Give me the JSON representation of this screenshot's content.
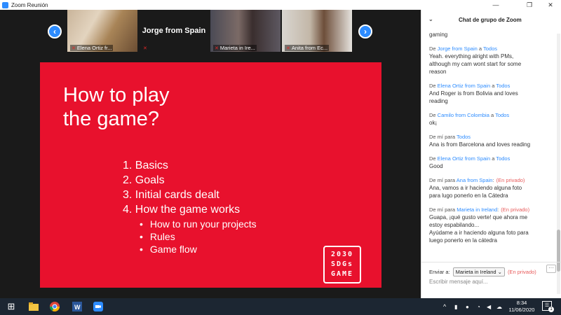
{
  "window": {
    "title": "Zoom Reunión",
    "minimize": "—",
    "restore": "❐",
    "close": "✕"
  },
  "gallery": {
    "prev_arrow": "‹",
    "next_arrow": "›",
    "tiles": [
      {
        "name": "Elena Ortiz fr..."
      },
      {
        "name": "Jorge from Spain"
      },
      {
        "name": "Marieta in Ire..."
      },
      {
        "name": "Anita from Ec..."
      }
    ],
    "mute_glyph": "✕"
  },
  "slide": {
    "title_line1": "How to play",
    "title_line2": "the game?",
    "items": [
      "1.  Basics",
      "2.  Goals",
      "3.  Initial cards dealt",
      "4.  How the game works"
    ],
    "subitems": [
      "How to run your projects",
      "Rules",
      "Game flow"
    ],
    "logo": [
      "2030",
      "SDGs",
      "GAME"
    ],
    "background": "#e8112d"
  },
  "chat": {
    "header_title": "Chat de grupo de Zoom",
    "collapse_icon": "⌄",
    "messages": [
      {
        "prefix": "",
        "who": "",
        "mid": "",
        "to": "",
        "private": "",
        "text": "gaming"
      },
      {
        "prefix": "De ",
        "who": "Jorge from Spain",
        "mid": " a ",
        "to": "Todos",
        "private": "",
        "text": "Yeah. everything alright with PMs,\nalthough my cam wont start for some\nreason"
      },
      {
        "prefix": "De ",
        "who": "Elena Ortiz from Spain",
        "mid": " a ",
        "to": "Todos",
        "private": "",
        "text": "And Roger is from Bolivia and loves\nreading"
      },
      {
        "prefix": "De ",
        "who": "Camilo from Colombia",
        "mid": " a ",
        "to": "Todos",
        "private": "",
        "text": "ok¡"
      },
      {
        "prefix": "De mí para ",
        "who": "Todos",
        "mid": "",
        "to": "",
        "private": "",
        "text": "Ana is from Barcelona and loves reading"
      },
      {
        "prefix": "De ",
        "who": "Elena Ortiz from Spain",
        "mid": " a ",
        "to": "Todos",
        "private": "",
        "text": "Good"
      },
      {
        "prefix": "De mí para ",
        "who": "Ana from Spain",
        "mid": ":",
        "to": "",
        "private": "(En privado)",
        "text": "Ana, vamos a ir haciendo alguna foto\npara lugo ponerlo en la Cátedra"
      },
      {
        "prefix": "De mí para ",
        "who": "Marieta in Ireland",
        "mid": ":",
        "to": "",
        "private": "(En privado)",
        "text": "Guapa, ¡qué gusto verte! que ahora me\nestoy espabilando...\nAyúdame a ir haciendo alguna foto para\nluego ponerlo en la cátedra"
      }
    ],
    "send_to_label": "Enviar a:",
    "send_to_value": "Marieta in Ireland",
    "send_to_private": "(En privado)",
    "more_button": "···",
    "input_placeholder": "Escribir mensaje aquí..."
  },
  "taskbar": {
    "windows_icon": "⊞",
    "clock_time": "8:34",
    "clock_date": "11/06/2020",
    "notification_count": "1",
    "tray_up": "^"
  },
  "colors": {
    "accent": "#2d8cff",
    "slide_red": "#e8112d",
    "private_red": "#e85b5b"
  }
}
